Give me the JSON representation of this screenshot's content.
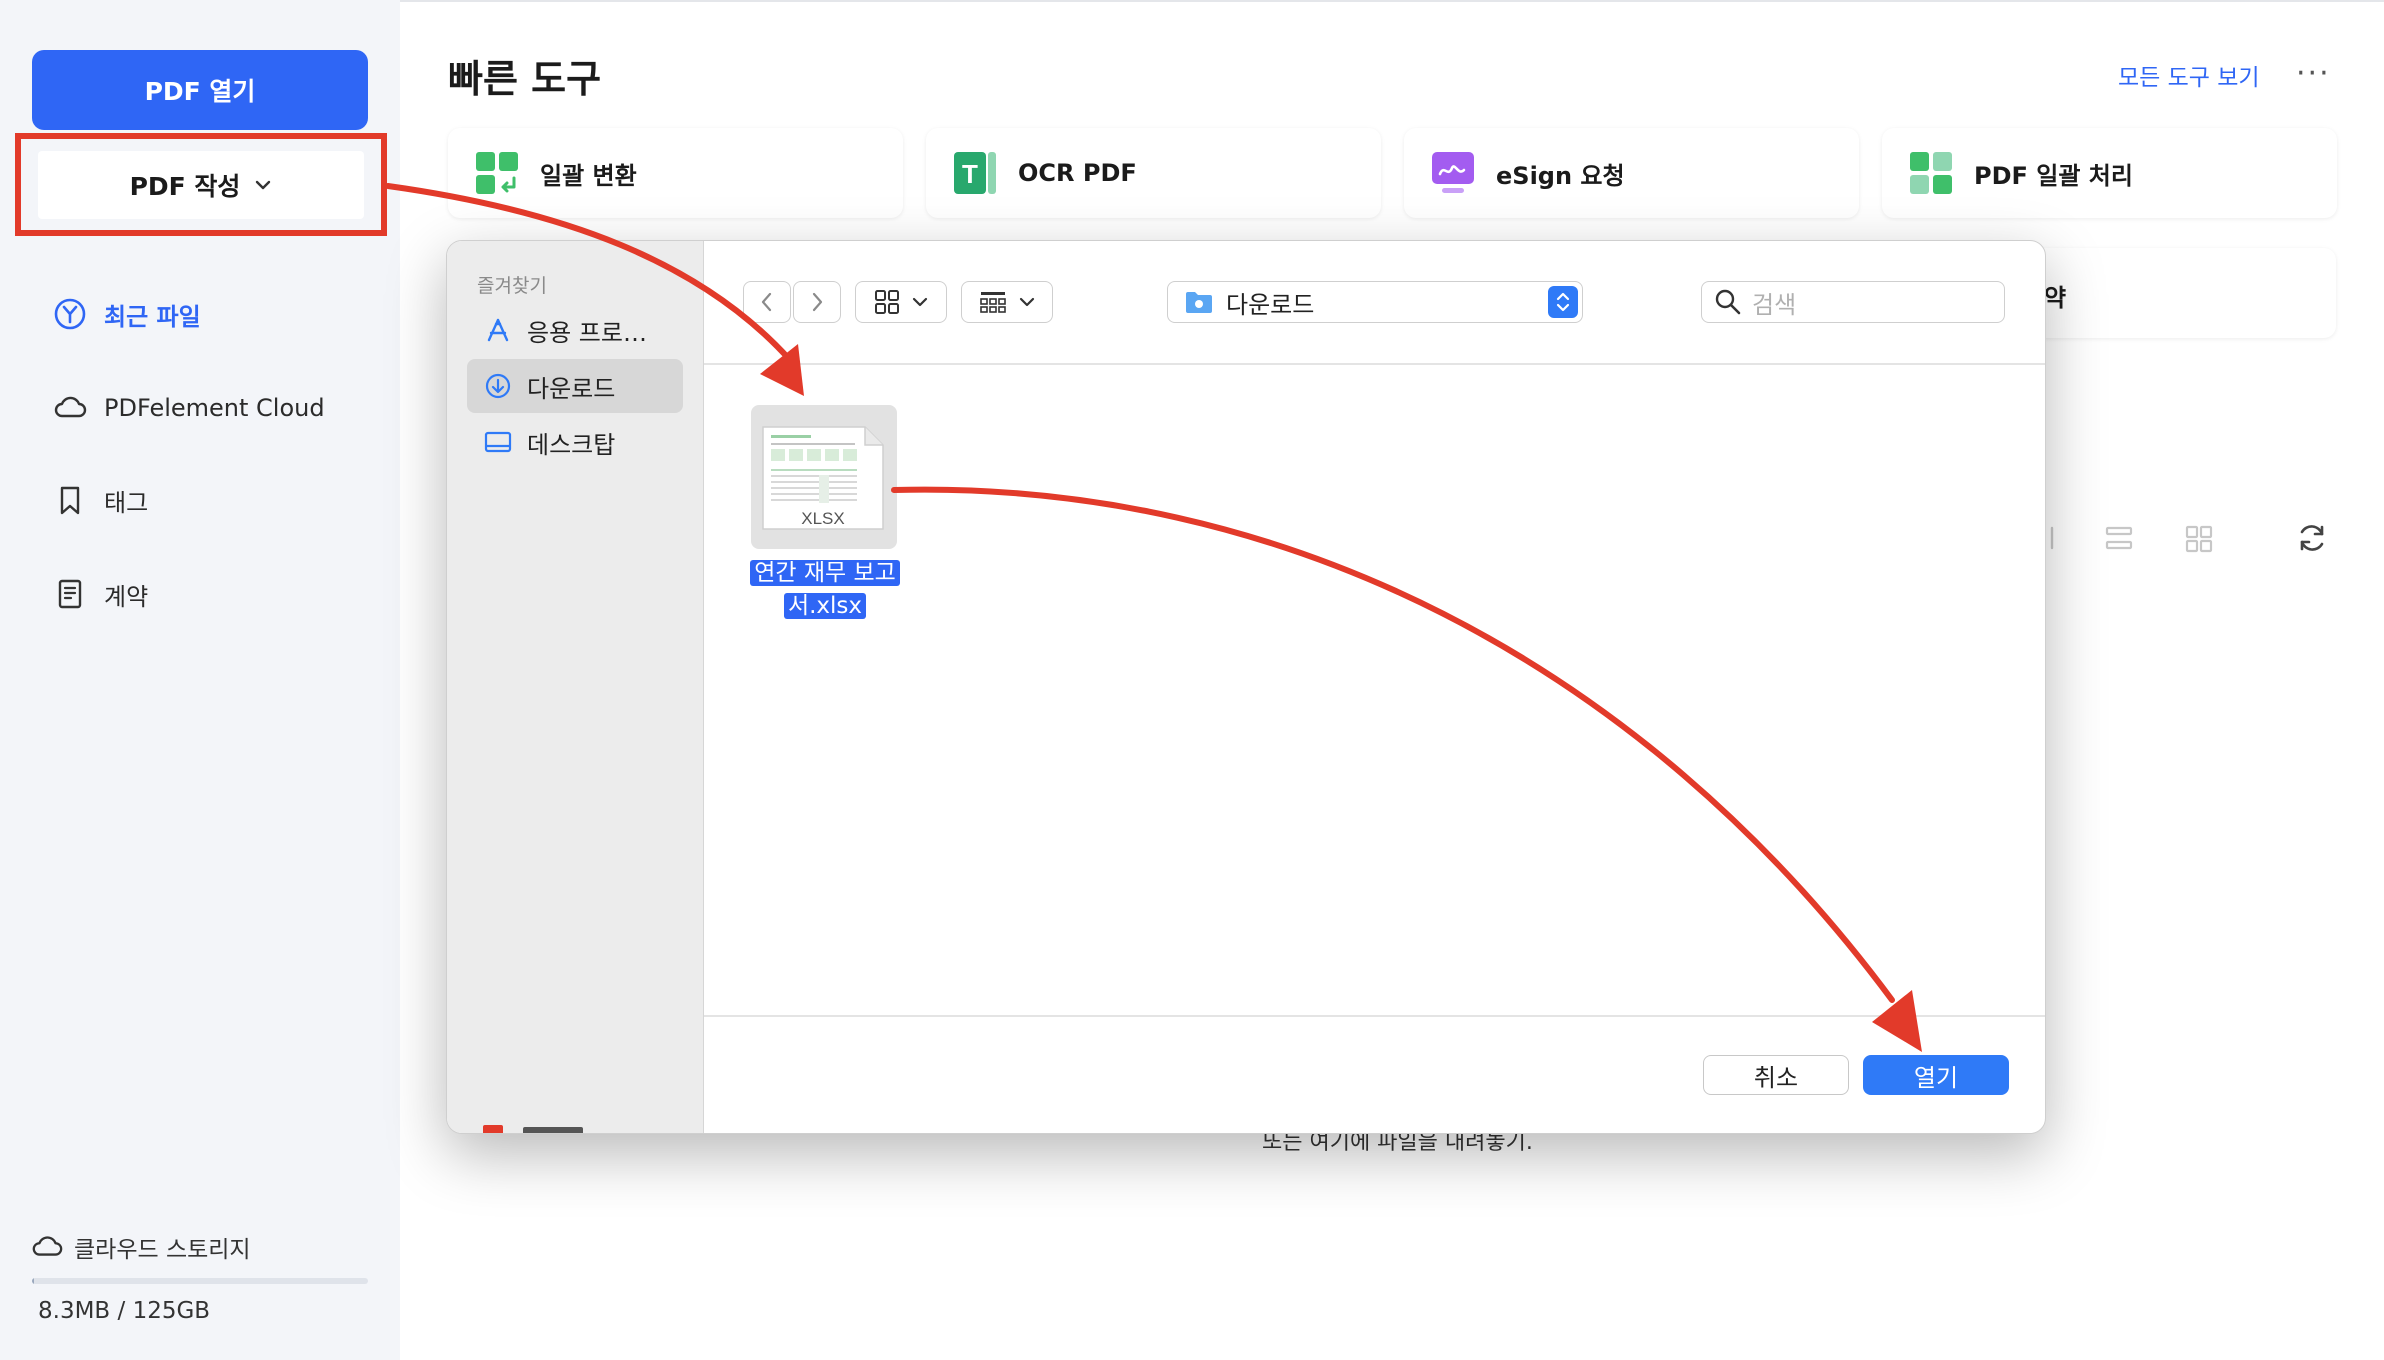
{
  "sidebar": {
    "open_pdf": "PDF 열기",
    "create_pdf": "PDF 작성",
    "nav": [
      {
        "label": "최근 파일",
        "icon": "recent-icon",
        "active": true
      },
      {
        "label": "PDFelement Cloud",
        "icon": "cloud-icon",
        "active": false
      },
      {
        "label": "태그",
        "icon": "bookmark-icon",
        "active": false
      },
      {
        "label": "계약",
        "icon": "contract-icon",
        "active": false
      }
    ],
    "storage": {
      "label": "클라우드 스토리지",
      "used": "8.3MB / 125GB",
      "fill_fraction": 0.0001
    }
  },
  "main": {
    "title": "빠른 도구",
    "all_tools": "모든 도구 보기",
    "more": "···",
    "tools": [
      {
        "label": "일괄 변환",
        "icon": "batch-convert-icon"
      },
      {
        "label": "OCR PDF",
        "icon": "ocr-icon"
      },
      {
        "label": "eSign 요청",
        "icon": "esign-icon"
      },
      {
        "label": "PDF 일괄 처리",
        "icon": "batch-process-icon"
      }
    ],
    "partial_card_text": "약",
    "drop_hint": "또는 여기에 파일을 내려놓기."
  },
  "dialog": {
    "favorites_title": "즐겨찾기",
    "favorites": [
      {
        "label": "응용 프로…",
        "icon": "applications-icon",
        "selected": false
      },
      {
        "label": "다운로드",
        "icon": "download-icon",
        "selected": true
      },
      {
        "label": "데스크탑",
        "icon": "desktop-icon",
        "selected": false
      }
    ],
    "path": "다운로드",
    "search_placeholder": "검색",
    "file": {
      "name": "연간 재무 보고서.xlsx",
      "name_line1": "연간 재무 보고",
      "name_line2": "서.xlsx",
      "thumb_label": "XLSX"
    },
    "cancel": "취소",
    "open": "열기"
  },
  "colors": {
    "accent": "#2f66f5",
    "annotation": "#e23a2a",
    "sidebar_bg": "#f3f5f9"
  }
}
